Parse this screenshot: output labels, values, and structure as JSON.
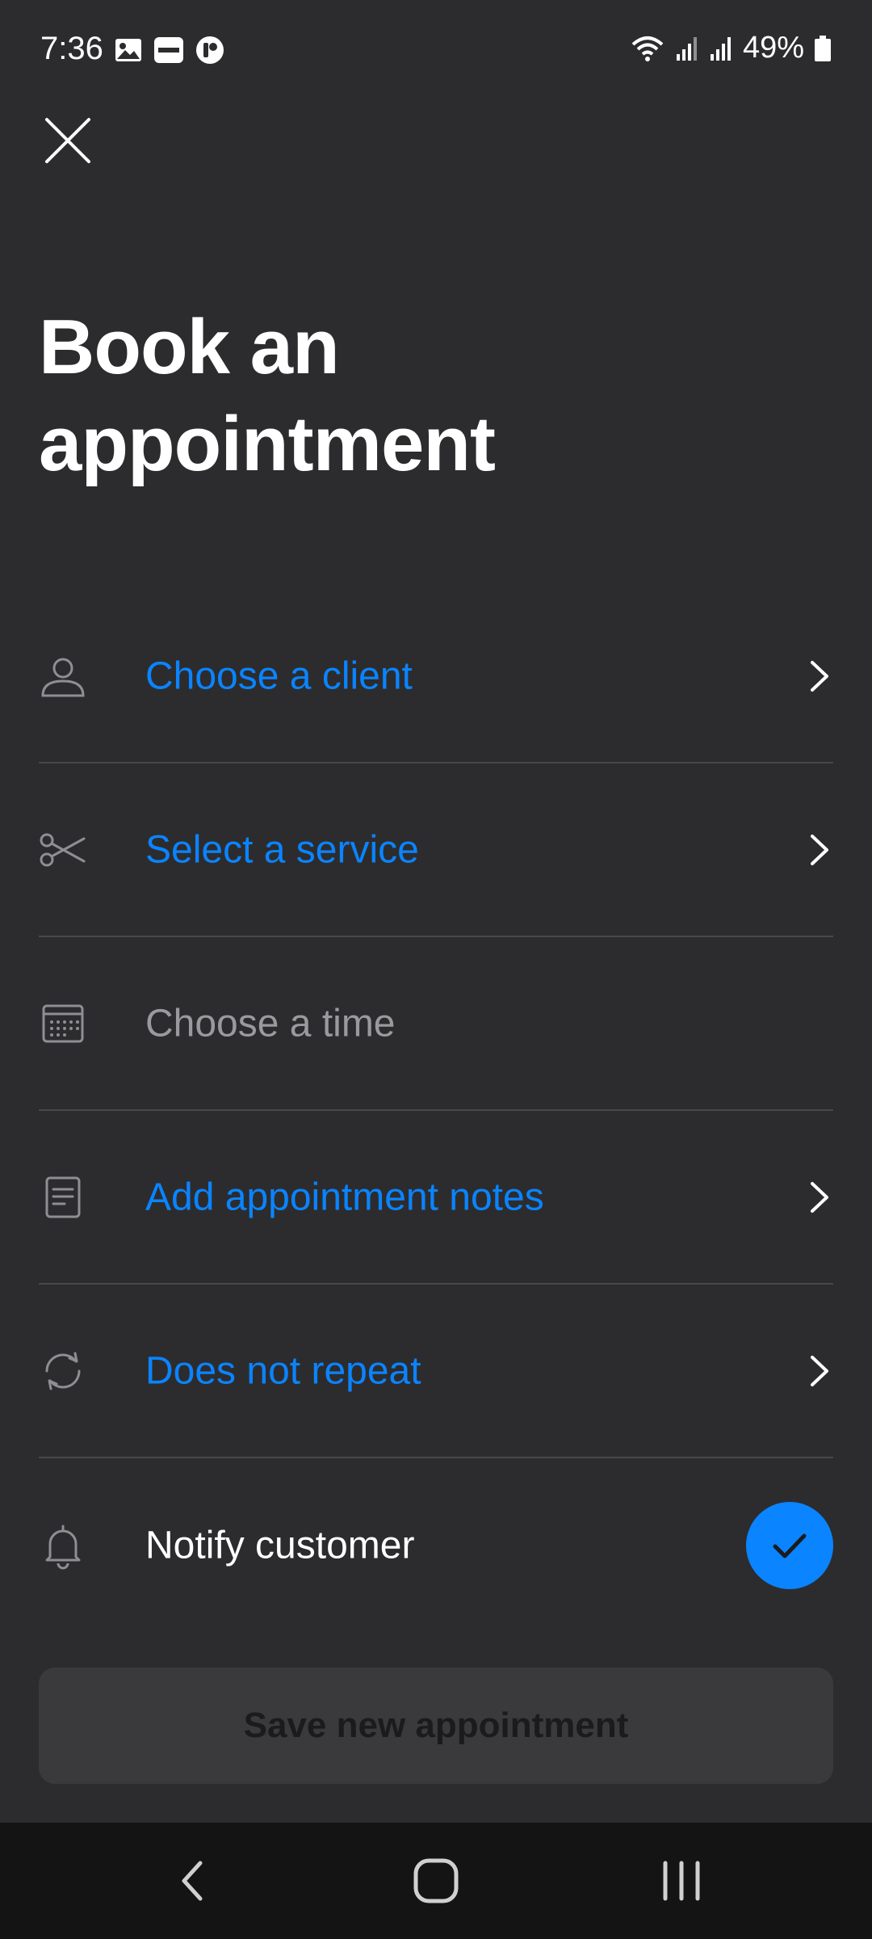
{
  "status_bar": {
    "time": "7:36",
    "left_icons": [
      "gallery-icon",
      "cisco-icon",
      "app-icon"
    ],
    "right_icons": [
      "wifi-icon",
      "signal-icon",
      "signal-roaming-icon",
      "battery-icon"
    ],
    "battery": "49%"
  },
  "header": {
    "close_icon": "close-icon",
    "title": "Book an appointment"
  },
  "rows": [
    {
      "icon": "person-icon",
      "label": "Choose a client",
      "color": "#0a84ff",
      "has_chevron": true
    },
    {
      "icon": "scissors-icon",
      "label": "Select a service",
      "color": "#0a84ff",
      "has_chevron": true
    },
    {
      "icon": "calendar-icon",
      "label": "Choose a time",
      "color": "#9a9a9e",
      "has_chevron": false
    },
    {
      "icon": "notes-icon",
      "label": "Add appointment notes",
      "color": "#0a84ff",
      "has_chevron": true
    },
    {
      "icon": "repeat-icon",
      "label": "Does not repeat",
      "color": "#0a84ff",
      "has_chevron": true
    },
    {
      "icon": "bell-icon",
      "label": "Notify customer",
      "color": "#ffffff",
      "checked": true
    }
  ],
  "footer": {
    "save_label": "Save new appointment"
  },
  "nav_bar": {
    "icons": [
      "back-icon",
      "home-icon",
      "recents-icon"
    ]
  },
  "colors": {
    "background": "#2c2c2e",
    "accent": "#0a84ff",
    "divider": "#48484a",
    "button_disabled": "#3a3a3c"
  }
}
